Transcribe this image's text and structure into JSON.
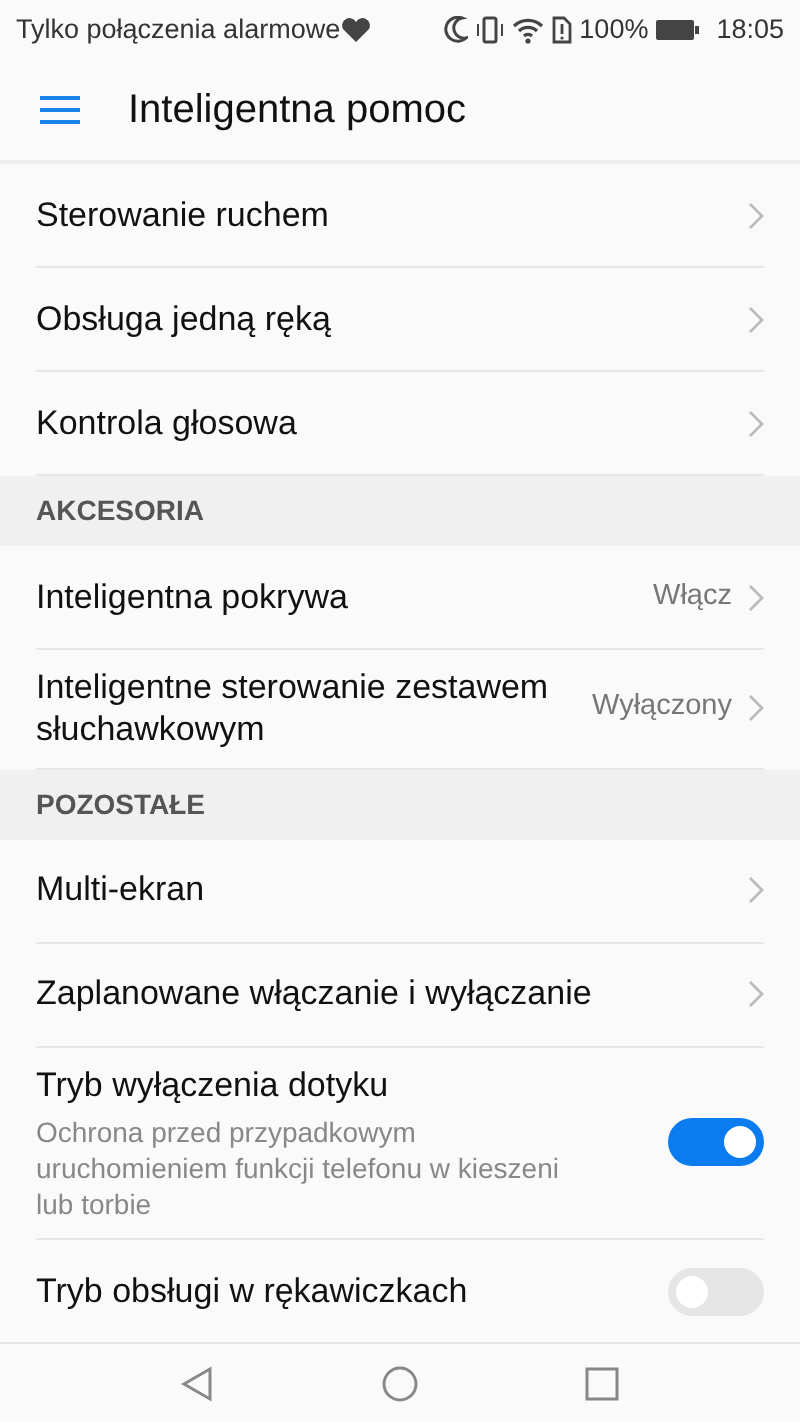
{
  "status_bar": {
    "carrier_text": "Tylko połączenia alarmowe",
    "battery": "100%",
    "time": "18:05"
  },
  "toolbar": {
    "title": "Inteligentna pomoc"
  },
  "sections": [
    {
      "items": [
        {
          "kind": "link",
          "label": "Sterowanie ruchem"
        },
        {
          "kind": "link",
          "label": "Obsługa jedną ręką"
        },
        {
          "kind": "link",
          "label": "Kontrola głosowa"
        }
      ]
    },
    {
      "header": "AKCESORIA",
      "items": [
        {
          "kind": "link",
          "label": "Inteligentna pokrywa",
          "value": "Włącz"
        },
        {
          "kind": "link",
          "label": "Inteligentne sterowanie zestawem słuchawkowym",
          "value": "Wyłączony"
        }
      ]
    },
    {
      "header": "POZOSTAŁE",
      "items": [
        {
          "kind": "link",
          "label": "Multi-ekran"
        },
        {
          "kind": "link",
          "label": "Zaplanowane włączanie i wyłączanie"
        },
        {
          "kind": "toggle",
          "label": "Tryb wyłączenia dotyku",
          "description": "Ochrona przed przypadkowym uruchomieniem funkcji telefonu w kieszeni lub torbie",
          "on": true
        },
        {
          "kind": "toggle",
          "label": "Tryb obsługi w rękawiczkach",
          "on": false
        }
      ]
    }
  ]
}
